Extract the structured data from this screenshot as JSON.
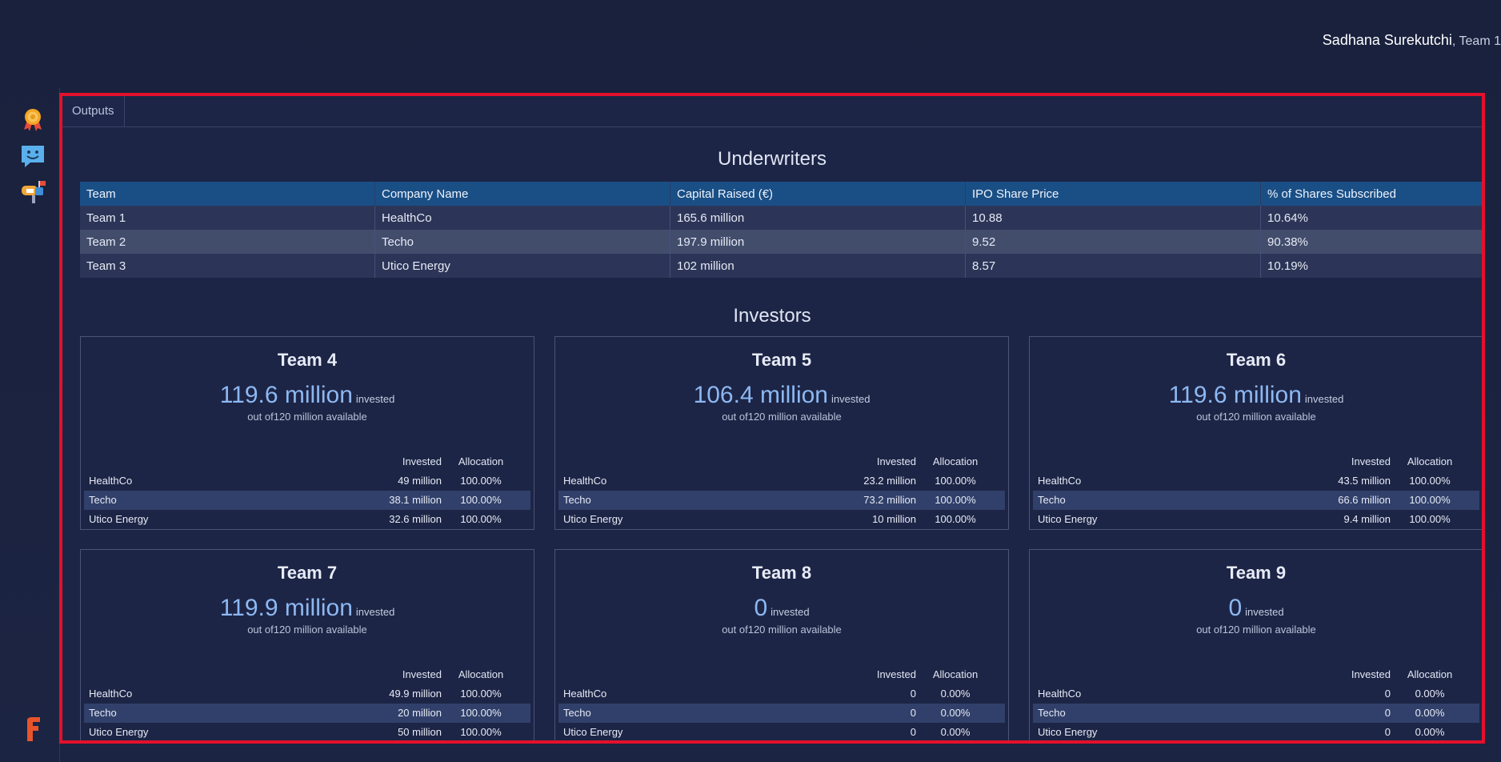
{
  "header": {
    "user_name": "Sadhana Surekutchi",
    "user_team": ", Team 1"
  },
  "sidebar": {
    "icons": [
      "award-icon",
      "chat-bubble-smile-icon",
      "mailbox-icon"
    ],
    "brand": "F"
  },
  "tabs": [
    {
      "label": "Outputs"
    }
  ],
  "underwriters": {
    "title": "Underwriters",
    "columns": [
      "Team",
      "Company Name",
      "Capital Raised (€)",
      "IPO Share Price",
      "% of Shares Subscribed"
    ],
    "rows": [
      [
        "Team 1",
        "HealthCo",
        "165.6 million",
        "10.88",
        "10.64%"
      ],
      [
        "Team 2",
        "Techo",
        "197.9 million",
        "9.52",
        "90.38%"
      ],
      [
        "Team 3",
        "Utico Energy",
        "102 million",
        "8.57",
        "10.19%"
      ]
    ]
  },
  "investors": {
    "title": "Investors",
    "invested_word": "invested",
    "available_text": "out of120 million available",
    "col_invested": "Invested",
    "col_allocation": "Allocation",
    "cards": [
      {
        "team": "Team 4",
        "total": "119.6 million",
        "rows": [
          [
            "HealthCo",
            "49 million",
            "100.00%"
          ],
          [
            "Techo",
            "38.1 million",
            "100.00%"
          ],
          [
            "Utico Energy",
            "32.6 million",
            "100.00%"
          ]
        ]
      },
      {
        "team": "Team 5",
        "total": "106.4 million",
        "rows": [
          [
            "HealthCo",
            "23.2 million",
            "100.00%"
          ],
          [
            "Techo",
            "73.2 million",
            "100.00%"
          ],
          [
            "Utico Energy",
            "10 million",
            "100.00%"
          ]
        ]
      },
      {
        "team": "Team 6",
        "total": "119.6 million",
        "rows": [
          [
            "HealthCo",
            "43.5 million",
            "100.00%"
          ],
          [
            "Techo",
            "66.6 million",
            "100.00%"
          ],
          [
            "Utico Energy",
            "9.4 million",
            "100.00%"
          ]
        ]
      },
      {
        "team": "Team 7",
        "total": "119.9 million",
        "rows": [
          [
            "HealthCo",
            "49.9 million",
            "100.00%"
          ],
          [
            "Techo",
            "20 million",
            "100.00%"
          ],
          [
            "Utico Energy",
            "50 million",
            "100.00%"
          ]
        ]
      },
      {
        "team": "Team 8",
        "total": "0",
        "rows": [
          [
            "HealthCo",
            "0",
            "0.00%"
          ],
          [
            "Techo",
            "0",
            "0.00%"
          ],
          [
            "Utico Energy",
            "0",
            "0.00%"
          ]
        ]
      },
      {
        "team": "Team 9",
        "total": "0",
        "rows": [
          [
            "HealthCo",
            "0",
            "0.00%"
          ],
          [
            "Techo",
            "0",
            "0.00%"
          ],
          [
            "Utico Energy",
            "0",
            "0.00%"
          ]
        ]
      }
    ]
  }
}
